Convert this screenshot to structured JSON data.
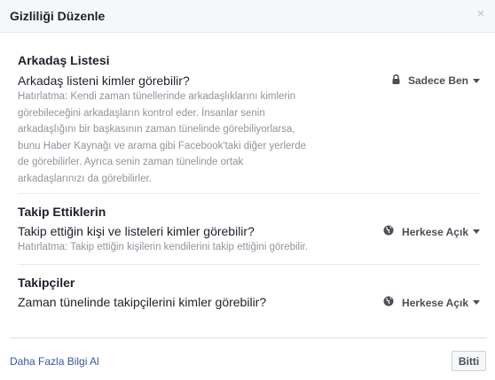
{
  "dialog": {
    "title": "Gizliliği Düzenle",
    "close_glyph": "×"
  },
  "sections": [
    {
      "title": "Arkadaş Listesi",
      "question": "Arkadaş listeni kimler görebilir?",
      "note_lines": [
        "Hatırlatma: Kendi zaman tünellerinde arkadaşlıklarını kimlerin",
        "görebileceğini arkadaşların kontrol eder. İnsanlar senin",
        "arkadaşlığını bir başkasının zaman tünelinde görebiliyorlarsa,",
        "bunu Haber Kaynağı ve arama gibi Facebook'taki diğer yerlerde",
        "de görebilirler. Ayrıca senin zaman tünelinde ortak",
        "arkadaşlarınızı da görebilirler."
      ],
      "audience": "Sadece Ben",
      "audience_icon": "lock-icon"
    },
    {
      "title": "Takip Ettiklerin",
      "question": "Takip ettiğin kişi ve listeleri kimler görebilir?",
      "note_lines": [
        "Hatırlatma: Takip ettiğin kişilerin kendilerini takip ettiğini görebilir."
      ],
      "audience": "Herkese Açık",
      "audience_icon": "globe-icon"
    },
    {
      "title": "Takipçiler",
      "question": "Zaman tünelinde takipçilerini kimler görebilir?",
      "note_lines": [],
      "audience": "Herkese Açık",
      "audience_icon": "globe-icon"
    }
  ],
  "footer": {
    "more_info_link": "Daha Fazla Bilgi Al",
    "done_button": "Bitti"
  }
}
